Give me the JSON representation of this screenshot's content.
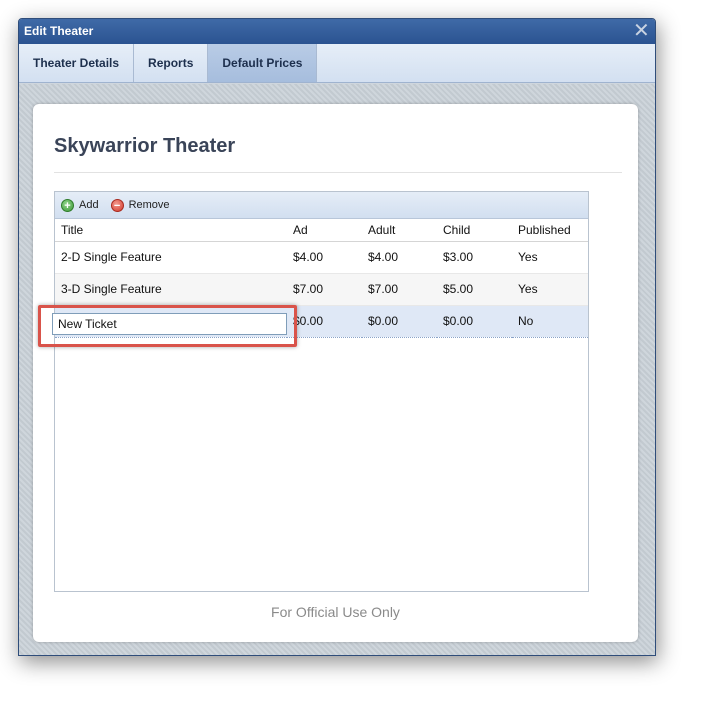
{
  "window": {
    "title": "Edit Theater",
    "close_glyph": "✕"
  },
  "tabs": [
    {
      "label": "Theater Details",
      "active": false
    },
    {
      "label": "Reports",
      "active": false
    },
    {
      "label": "Default Prices",
      "active": true
    }
  ],
  "page": {
    "title": "Skywarrior Theater",
    "footer": "For Official Use Only"
  },
  "toolbar": {
    "add_label": "Add",
    "add_icon": "add-circle-icon",
    "remove_label": "Remove",
    "remove_icon": "remove-circle-icon"
  },
  "grid": {
    "columns": [
      "Title",
      "Ad",
      "Adult",
      "Child",
      "Published"
    ],
    "rows": [
      {
        "title": "2-D Single Feature",
        "ad": "$4.00",
        "adult": "$4.00",
        "child": "$3.00",
        "published": "Yes"
      },
      {
        "title": "3-D Single Feature",
        "ad": "$7.00",
        "adult": "$7.00",
        "child": "$5.00",
        "published": "Yes"
      },
      {
        "title": "",
        "ad": "$0.00",
        "adult": "$0.00",
        "child": "$0.00",
        "published": "No"
      }
    ],
    "editor_value": "New Ticket"
  },
  "colors": {
    "titlebar": "#2b5391",
    "highlight": "#d9534a",
    "selected_row": "#dfe8f6"
  }
}
